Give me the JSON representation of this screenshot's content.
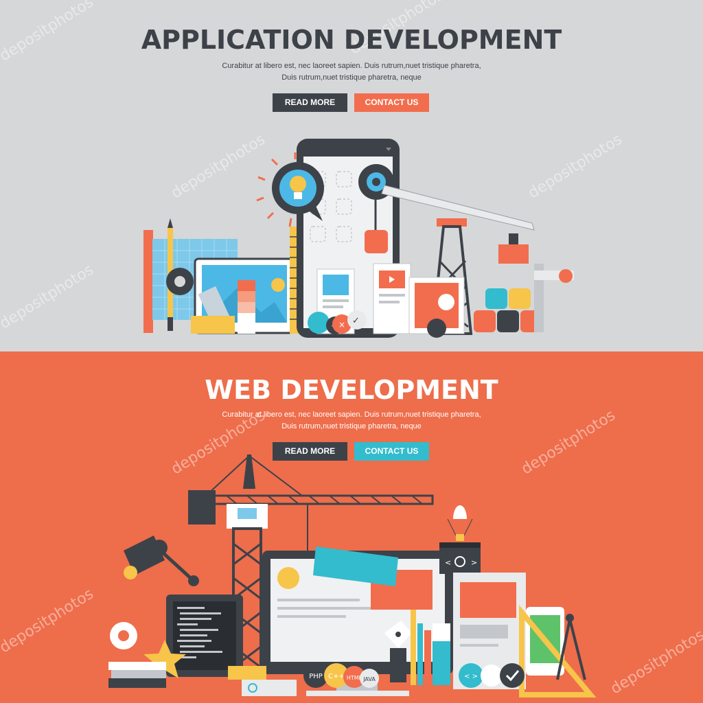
{
  "colors": {
    "top_bg": "#d6d7d8",
    "bottom_bg": "#ee6d4b",
    "dark": "#3d4249",
    "orange": "#f26d4e",
    "teal": "#33bccd",
    "yellow": "#f6c54a"
  },
  "app": {
    "title": "APPLICATION DEVELOPMENT",
    "desc_line1": "Curabitur at libero est, nec laoreet sapien. Duis rutrum,nuet tristique pharetra,",
    "desc_line2": "Duis rutrum,nuet tristique pharetra, neque",
    "read_more": "READ MORE",
    "contact": "CONTACT US"
  },
  "web": {
    "title": "WEB DEVELOPMENT",
    "desc_line1": "Curabitur at libero est, nec laoreet sapien. Duis rutrum,nuet tristique pharetra,",
    "desc_line2": "Duis rutrum,nuet tristique pharetra, neque",
    "read_more": "READ MORE",
    "contact": "CONTACT US",
    "badges": {
      "php": "PHP",
      "cpp": "C++",
      "html": "HTML",
      "java": "JAVA"
    },
    "code_tag": "< >"
  },
  "watermark": "depositphotos",
  "icons": [
    "lightbulb-icon",
    "gear-icon",
    "phone-icon",
    "tablet-icon",
    "pencil-icon",
    "ruler-icon",
    "oil-derrick-icon",
    "crane-icon",
    "monitor-icon",
    "desk-lamp-icon",
    "star-icon",
    "parachute-icon",
    "pen-nib-icon",
    "compass-icon",
    "checkmark-icon"
  ]
}
